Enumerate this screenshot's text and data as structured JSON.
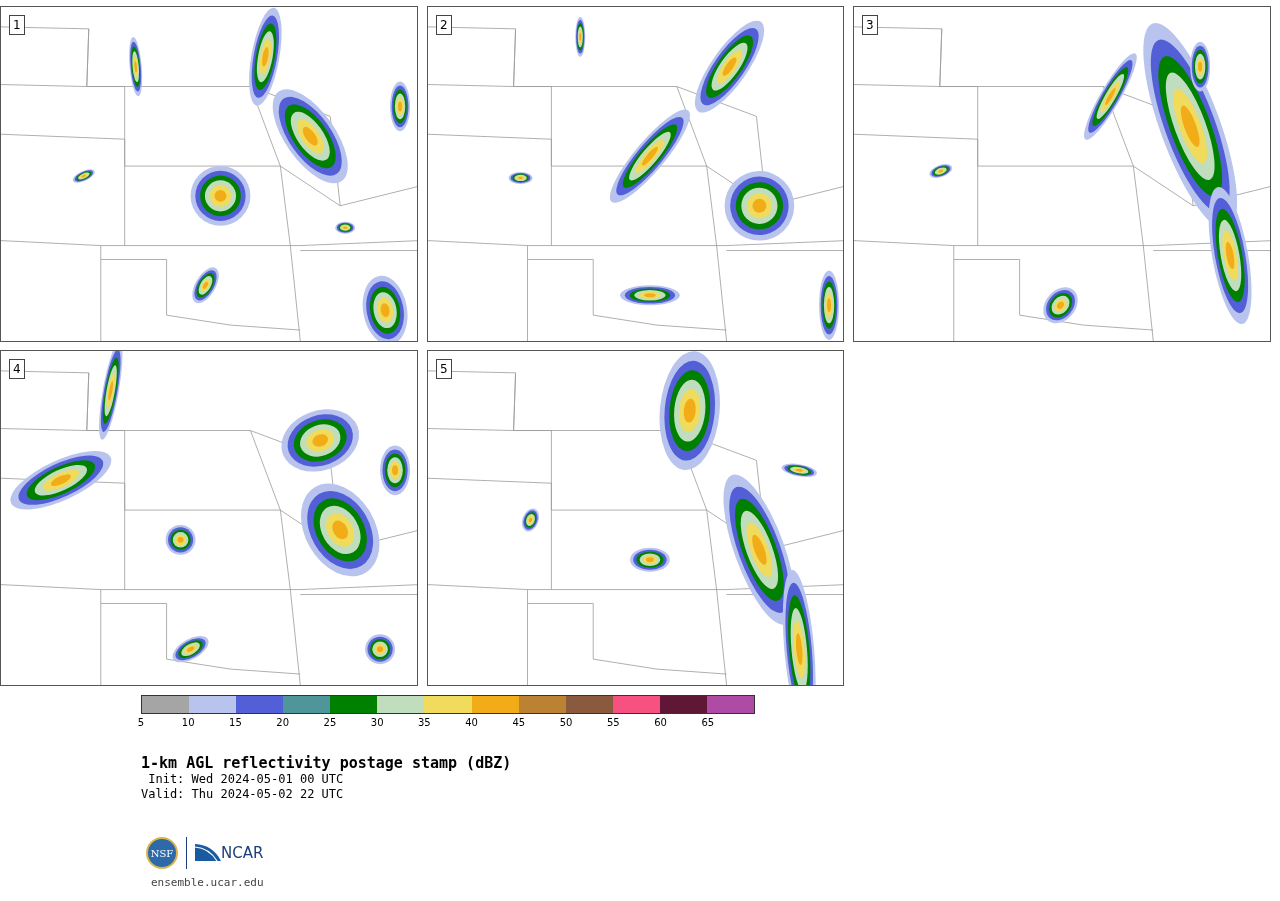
{
  "panels": [
    {
      "label": "1"
    },
    {
      "label": "2"
    },
    {
      "label": "3"
    },
    {
      "label": "4"
    },
    {
      "label": "5"
    }
  ],
  "colorbar": {
    "bins": [
      {
        "color": "#a5a5a5"
      },
      {
        "color": "#b8c3ee"
      },
      {
        "color": "#525fd6"
      },
      {
        "color": "#4f969b"
      },
      {
        "color": "#008000"
      },
      {
        "color": "#c0ddbe"
      },
      {
        "color": "#f0db5c"
      },
      {
        "color": "#f1ac17"
      },
      {
        "color": "#ba8232"
      },
      {
        "color": "#8a5a3e"
      },
      {
        "color": "#f65180"
      },
      {
        "color": "#5f1735"
      },
      {
        "color": "#ad4ba5"
      }
    ],
    "ticks": [
      "5",
      "10",
      "15",
      "20",
      "25",
      "30",
      "35",
      "40",
      "45",
      "50",
      "55",
      "60",
      "65"
    ]
  },
  "title": "1-km AGL reflectivity postage stamp (dBZ)",
  "init": "Init: Wed 2024-05-01 00 UTC",
  "valid": "Valid: Thu 2024-05-02 22 UTC",
  "logo": {
    "left": "NSF",
    "right": "NCAR"
  },
  "url": "ensemble.ucar.edu"
}
